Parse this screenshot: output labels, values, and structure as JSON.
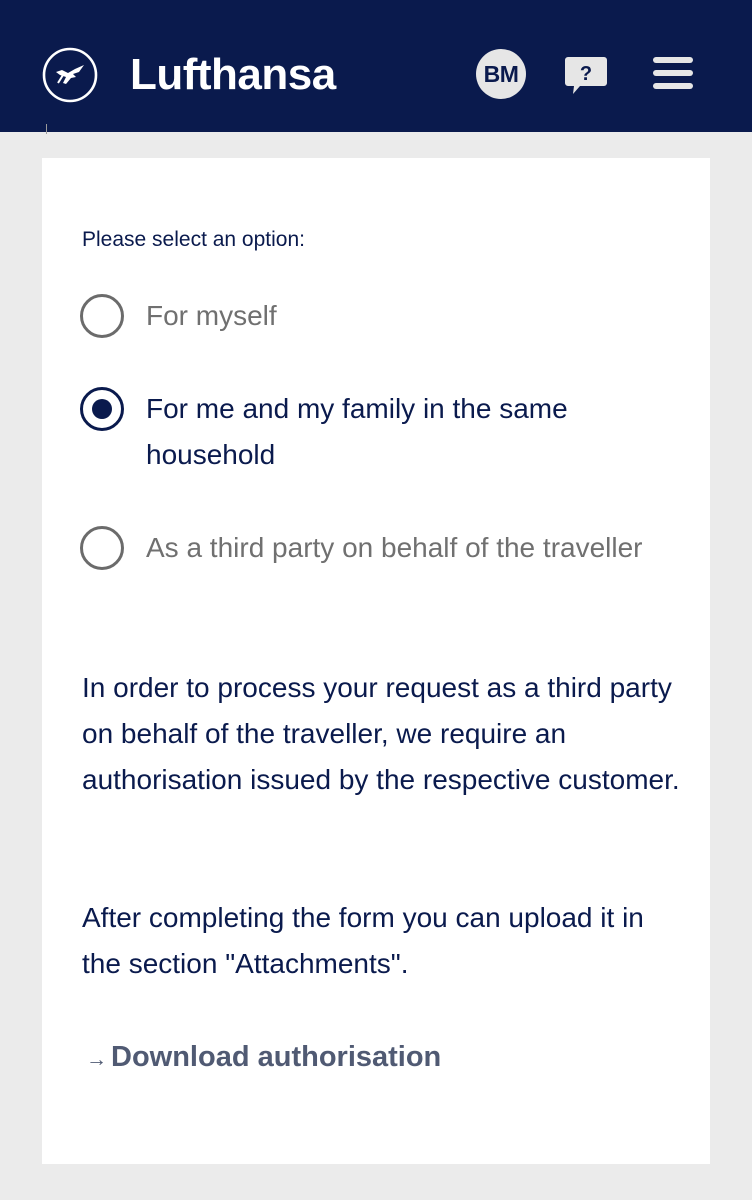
{
  "header": {
    "brand": "Lufthansa",
    "avatar_initials": "BM",
    "help_glyph": "?",
    "icons": {
      "logo": "crane-logo-icon",
      "help": "help-speech-bubble-icon",
      "menu": "hamburger-menu-icon"
    },
    "colors": {
      "background": "#0a1a4d",
      "foreground": "#ffffff"
    }
  },
  "form": {
    "prompt": "Please select an option:",
    "options": [
      {
        "label": "For myself",
        "selected": false
      },
      {
        "label": "For me and my family in the same household",
        "selected": true
      },
      {
        "label": "As a third party on behalf of the traveller",
        "selected": false
      }
    ],
    "info_paragraphs": [
      "In order to process your request as a third party on behalf of the traveller, we require an authorisation issued by the respective customer.",
      "After completing the form you can upload it in the section \"Attachments\"."
    ],
    "download_link": {
      "arrow": "→",
      "label": "Download authorisation"
    }
  }
}
